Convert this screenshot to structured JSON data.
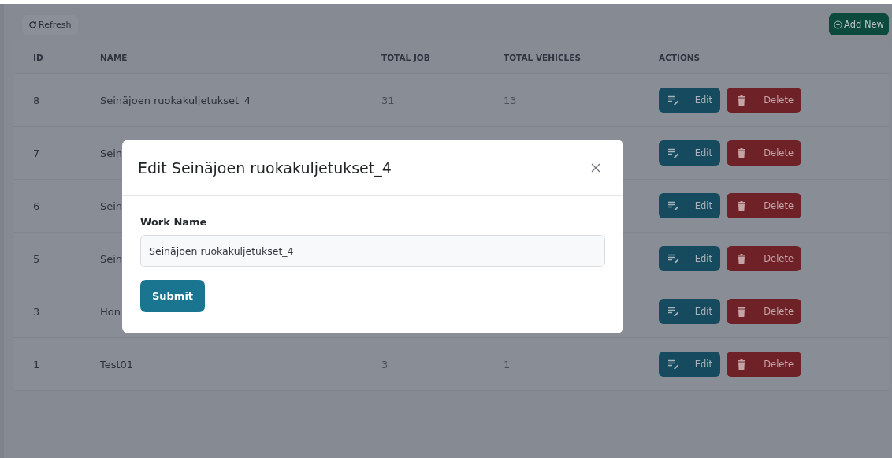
{
  "toolbar": {
    "refresh": "Refresh",
    "add_new": "Add New"
  },
  "table": {
    "columns": [
      "ID",
      "NAME",
      "TOTAL JOB",
      "TOTAL VEHICLES",
      "ACTIONS"
    ],
    "rows": [
      {
        "id": "8",
        "name": "Seinäjoen ruokakuljetukset_4",
        "total_job": "31",
        "total_vehicles": "13",
        "edit": "Edit",
        "delete": "Delete"
      },
      {
        "id": "7",
        "name": "Sein",
        "edit": "Edit",
        "delete": "Delete"
      },
      {
        "id": "6",
        "name": "Sein",
        "edit": "Edit",
        "delete": "Delete"
      },
      {
        "id": "5",
        "name": "Sein",
        "edit": "Edit",
        "delete": "Delete"
      },
      {
        "id": "3",
        "name": "Hon",
        "edit": "Edit",
        "delete": "Delete"
      },
      {
        "id": "1",
        "name": "Test01",
        "total_job": "3",
        "total_vehicles": "1",
        "edit": "Edit",
        "delete": "Delete"
      }
    ]
  },
  "modal": {
    "title": "Edit Seinäjoen ruokakuljetukset_4",
    "field_label": "Work Name",
    "field_value": "Seinäjoen ruokakuljetukset_4",
    "submit": "Submit"
  }
}
